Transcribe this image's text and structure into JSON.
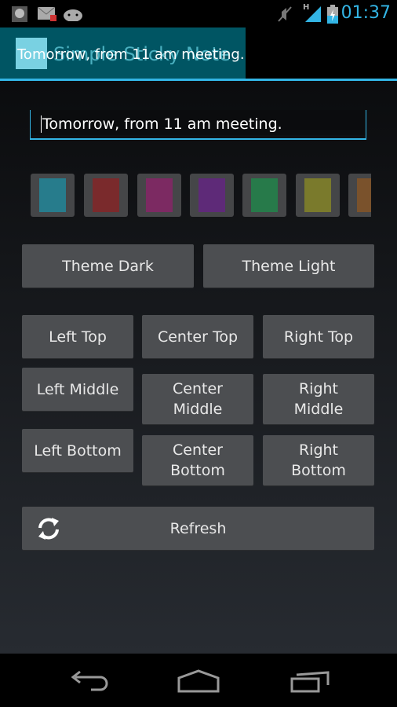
{
  "status_bar": {
    "time": "01:37",
    "network": "H",
    "icons": [
      "voicemail-icon",
      "mail-icon",
      "android-icon",
      "mute-icon",
      "signal-icon",
      "battery-charging-icon"
    ]
  },
  "widget_preview": {
    "app_title": "Simple Sticky Note",
    "note_text": "Tomorrow, from 11 am meeting.",
    "background_color": "#005563"
  },
  "note_input": {
    "value": "Tomorrow, from 11 am meeting."
  },
  "colors": [
    "#277c8c",
    "#7a2a2c",
    "#7c2a62",
    "#5e2a78",
    "#277a4a",
    "#7a7a2c",
    "#7a522c"
  ],
  "theme_buttons": {
    "dark": "Theme Dark",
    "light": "Theme Light"
  },
  "positions": {
    "left_top": "Left Top",
    "left_middle": "Left Middle",
    "left_bottom": "Left Bottom",
    "center_top": "Center Top",
    "center_middle": "Center Middle",
    "center_bottom": "Center Bottom",
    "right_top": "Right Top",
    "right_middle": "Right Middle",
    "right_bottom": "Right Bottom"
  },
  "refresh_label": "Refresh",
  "accent": "#33b5e5"
}
